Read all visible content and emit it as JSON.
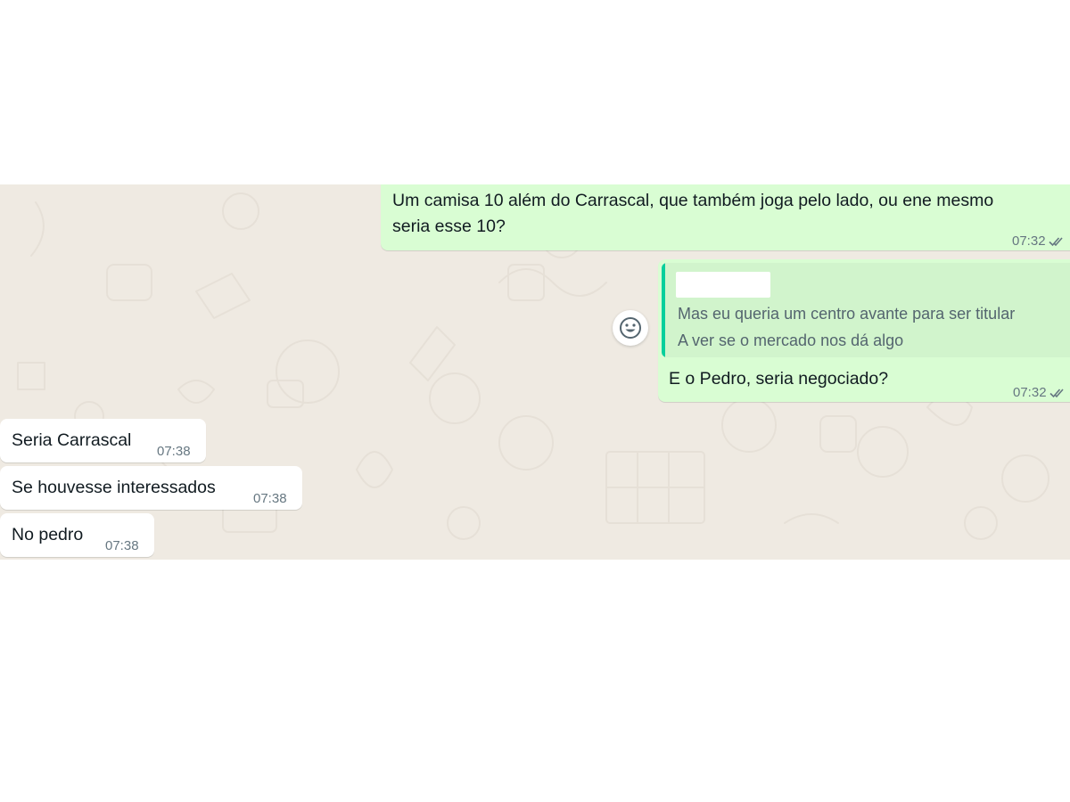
{
  "messages": {
    "out1": {
      "text": "Um camisa 10 além do Carrascal, que também joga pelo lado, ou ene mesmo\nseria esse 10?",
      "time": "07:32",
      "status_icon": "double-check-icon"
    },
    "out2": {
      "quote_text": "Mas eu queria um centro avante para ser titular\nA ver se o mercado nos dá algo",
      "text": "E o Pedro, seria negociado?",
      "time": "07:32",
      "status_icon": "double-check-icon"
    },
    "in1": {
      "text": "Seria Carrascal",
      "time": "07:38"
    },
    "in2": {
      "text": "Se houvesse interessados",
      "time": "07:38"
    },
    "in3": {
      "text": "No pedro",
      "time": "07:38"
    }
  },
  "colors": {
    "chat_background": "#efeae2",
    "outgoing_bubble": "#d9fdd3",
    "incoming_bubble": "#ffffff",
    "quote_bar": "#06cf9c",
    "meta_text": "#667781"
  },
  "icons": {
    "reaction": "emoji-smiley-icon"
  }
}
